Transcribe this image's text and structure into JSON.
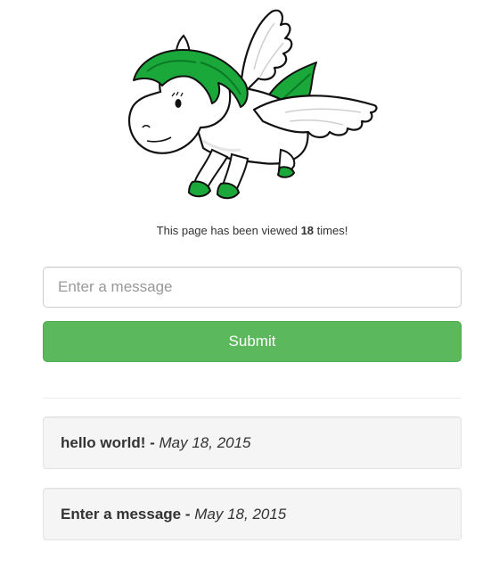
{
  "counter": {
    "prefix": "This page has been viewed ",
    "count": "18",
    "suffix": " times!"
  },
  "form": {
    "placeholder": "Enter a message",
    "submit_label": "Submit"
  },
  "messages": [
    {
      "text": "hello world!",
      "separator": " - ",
      "date": "May 18, 2015"
    },
    {
      "text": "Enter a message",
      "separator": " - ",
      "date": "May 18, 2015"
    }
  ],
  "colors": {
    "accent": "#5cb85c",
    "mane": "#1aa83a",
    "well_bg": "#f5f5f5"
  },
  "icons": {
    "mascot": "winged-unicorn-icon"
  }
}
